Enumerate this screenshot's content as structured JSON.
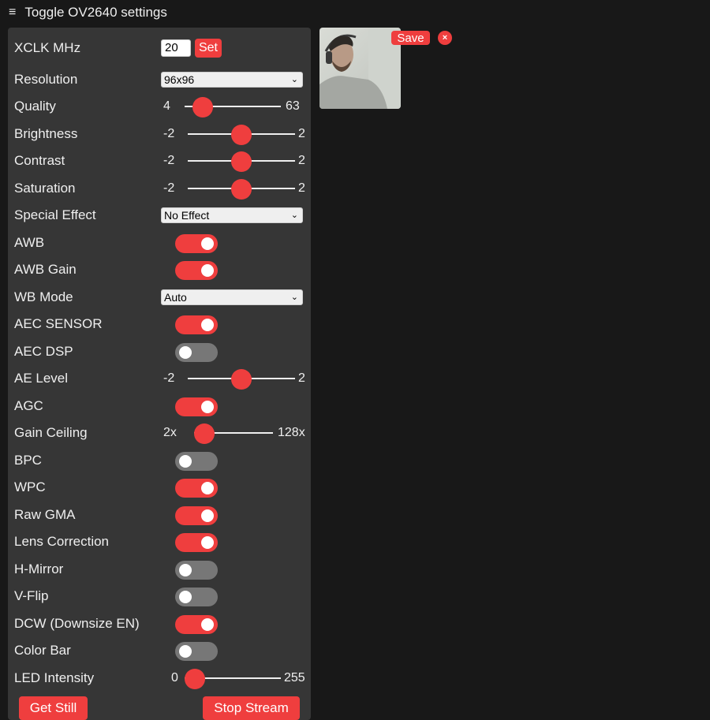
{
  "header": {
    "menu_icon": "hamburger-icon",
    "menu_glyph": "≡",
    "title": "Toggle OV2640 settings"
  },
  "xclk": {
    "label": "XCLK MHz",
    "value": "20",
    "set_label": "Set"
  },
  "resolution": {
    "label": "Resolution",
    "value": "96x96"
  },
  "quality": {
    "label": "Quality",
    "min": "4",
    "max": "63",
    "fraction": 0.1
  },
  "brightness": {
    "label": "Brightness",
    "min": "-2",
    "max": "2",
    "fraction": 0.5
  },
  "contrast": {
    "label": "Contrast",
    "min": "-2",
    "max": "2",
    "fraction": 0.5
  },
  "saturation": {
    "label": "Saturation",
    "min": "-2",
    "max": "2",
    "fraction": 0.5
  },
  "special_effect": {
    "label": "Special Effect",
    "value": "No Effect"
  },
  "awb": {
    "label": "AWB",
    "on": true
  },
  "awb_gain": {
    "label": "AWB Gain",
    "on": true
  },
  "wb_mode": {
    "label": "WB Mode",
    "value": "Auto"
  },
  "aec_sensor": {
    "label": "AEC SENSOR",
    "on": true
  },
  "aec_dsp": {
    "label": "AEC DSP",
    "on": false
  },
  "ae_level": {
    "label": "AE Level",
    "min": "-2",
    "max": "2",
    "fraction": 0.5
  },
  "agc": {
    "label": "AGC",
    "on": true
  },
  "gain_ceiling": {
    "label": "Gain Ceiling",
    "min": "2x",
    "max": "128x",
    "fraction": 0.0
  },
  "bpc": {
    "label": "BPC",
    "on": false
  },
  "wpc": {
    "label": "WPC",
    "on": true
  },
  "raw_gma": {
    "label": "Raw GMA",
    "on": true
  },
  "lens_correction": {
    "label": "Lens Correction",
    "on": true
  },
  "h_mirror": {
    "label": "H-Mirror",
    "on": false
  },
  "v_flip": {
    "label": "V-Flip",
    "on": false
  },
  "dcw": {
    "label": "DCW (Downsize EN)",
    "on": true
  },
  "color_bar": {
    "label": "Color Bar",
    "on": false
  },
  "led_intensity": {
    "label": "LED Intensity",
    "min": "0",
    "max": "255",
    "fraction": 0.0
  },
  "buttons": {
    "get_still": "Get Still",
    "stop_stream": "Stop Stream"
  },
  "preview": {
    "save_label": "Save",
    "close_glyph": "×"
  },
  "colors": {
    "accent": "#ef3e3e",
    "panel": "#363636",
    "background": "#181818",
    "switch_off": "#777777"
  }
}
